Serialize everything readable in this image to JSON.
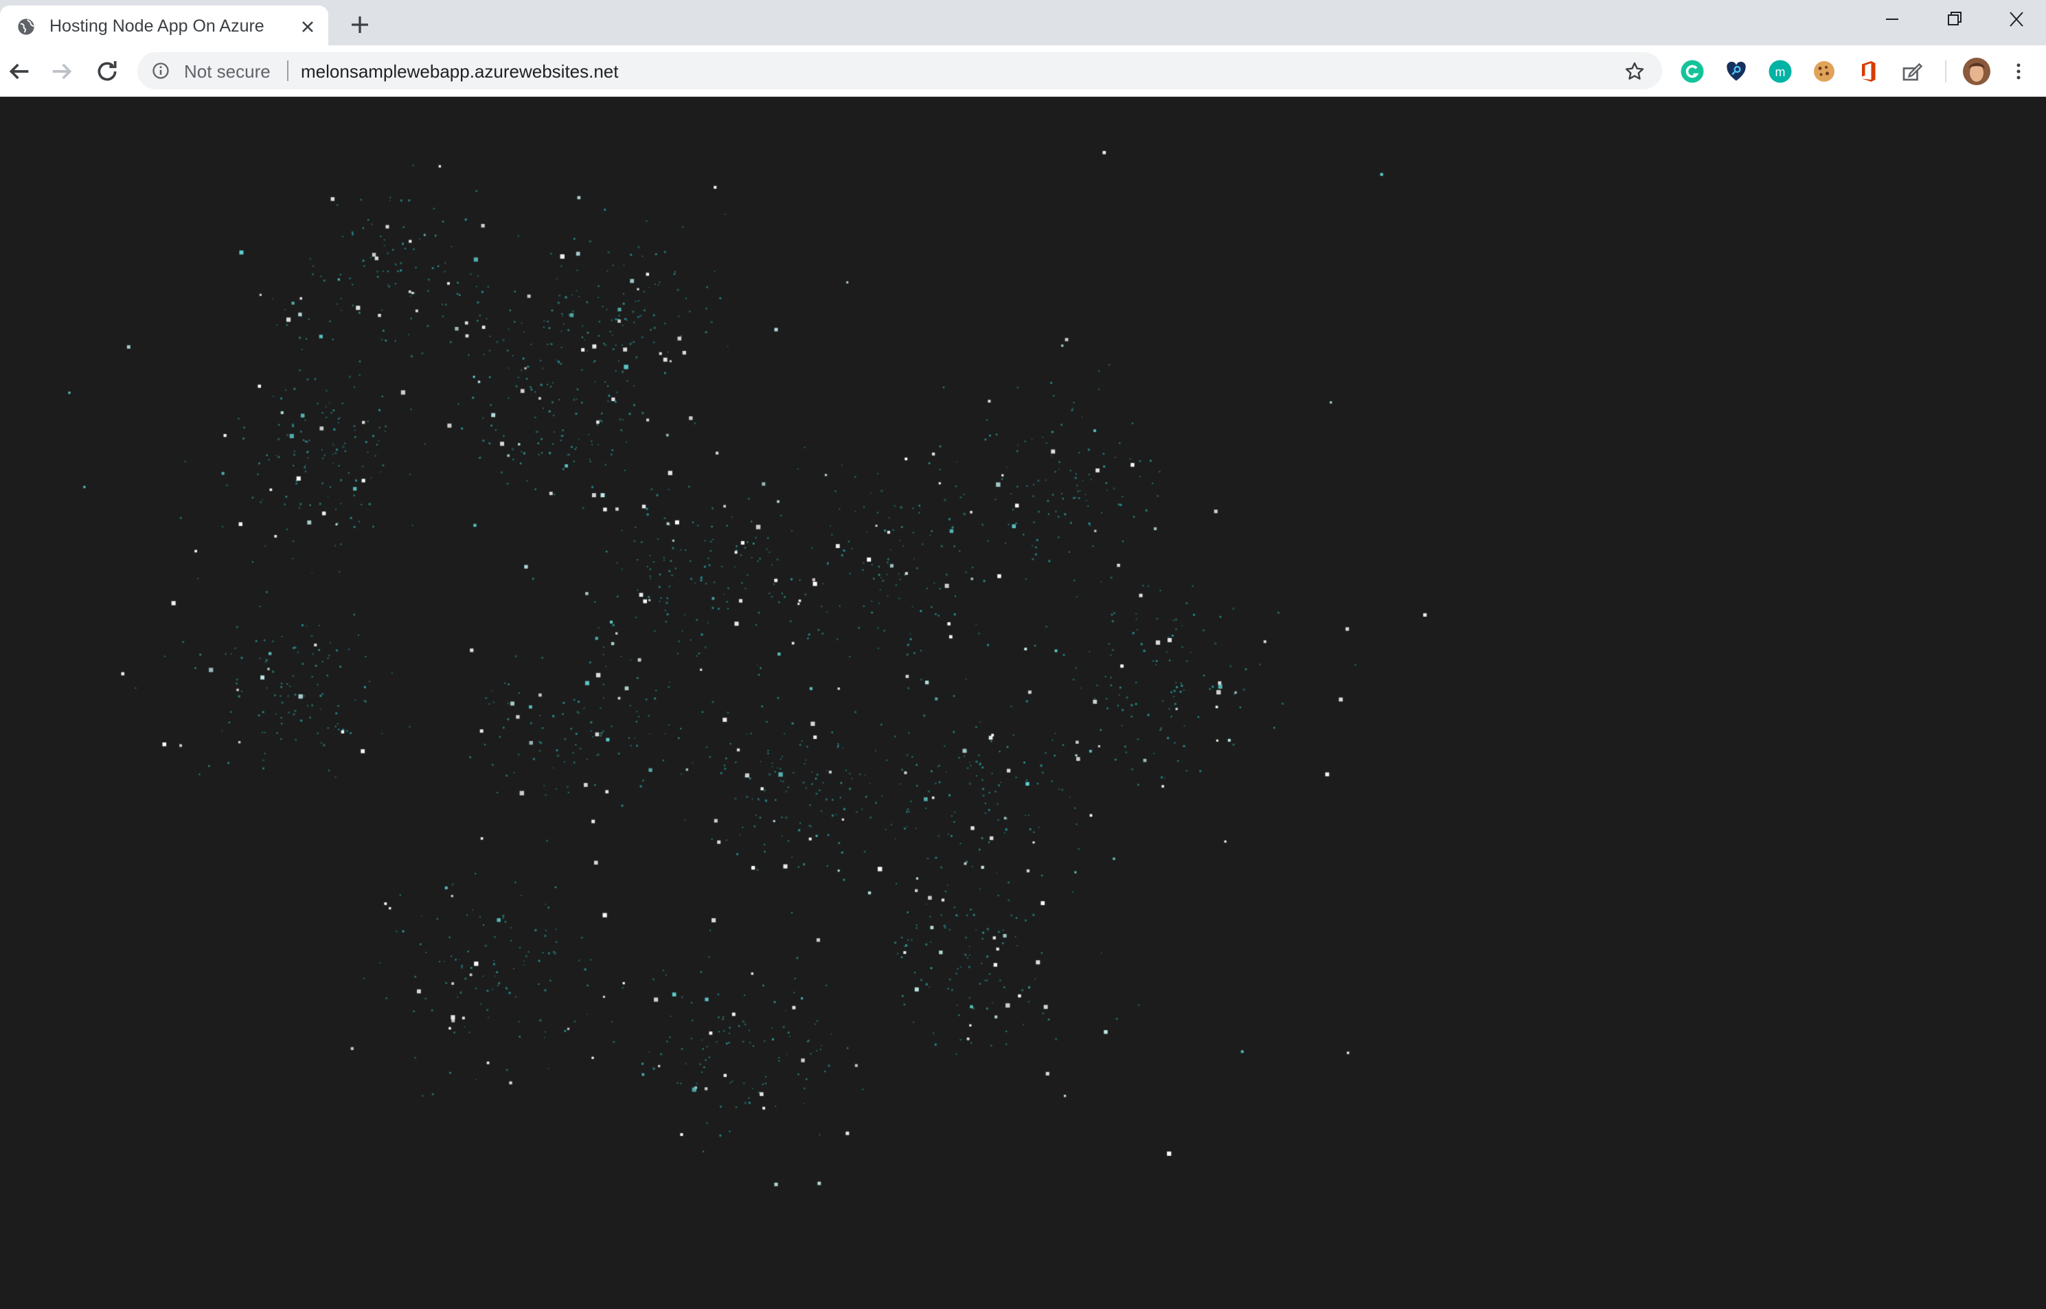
{
  "tab": {
    "title": "Hosting Node App On Azure",
    "favicon": "globe-icon",
    "close_icon": "close-icon"
  },
  "new_tab_icon": "plus-icon",
  "window_controls": [
    "minimize-icon",
    "restore-icon",
    "close-icon"
  ],
  "toolbar": {
    "back_icon": "arrow-left-icon",
    "forward_icon": "arrow-right-icon",
    "reload_icon": "reload-icon",
    "security_icon": "info-icon",
    "security_label": "Not secure",
    "url": "melonsamplewebapp.azurewebsites.net",
    "bookmark_icon": "star-icon",
    "extensions": [
      "grammarly-icon",
      "password-manager-icon",
      "circle-m-icon",
      "cookie-icon",
      "office-icon",
      "edit-icon"
    ],
    "menu_icon": "more-vertical-icon"
  },
  "page": {
    "background": "#1c1c1c",
    "particle_colors": [
      "#ffffff",
      "#bfeaea",
      "#2aa3a3",
      "#5fd0d0"
    ],
    "bright_particles": 340,
    "dim_particles": 1700
  },
  "colors": {
    "tabstrip": "#dee1e6",
    "toolbar": "#ffffff",
    "omnibox": "#f1f3f4",
    "accent_teal": "#00b3a4"
  }
}
